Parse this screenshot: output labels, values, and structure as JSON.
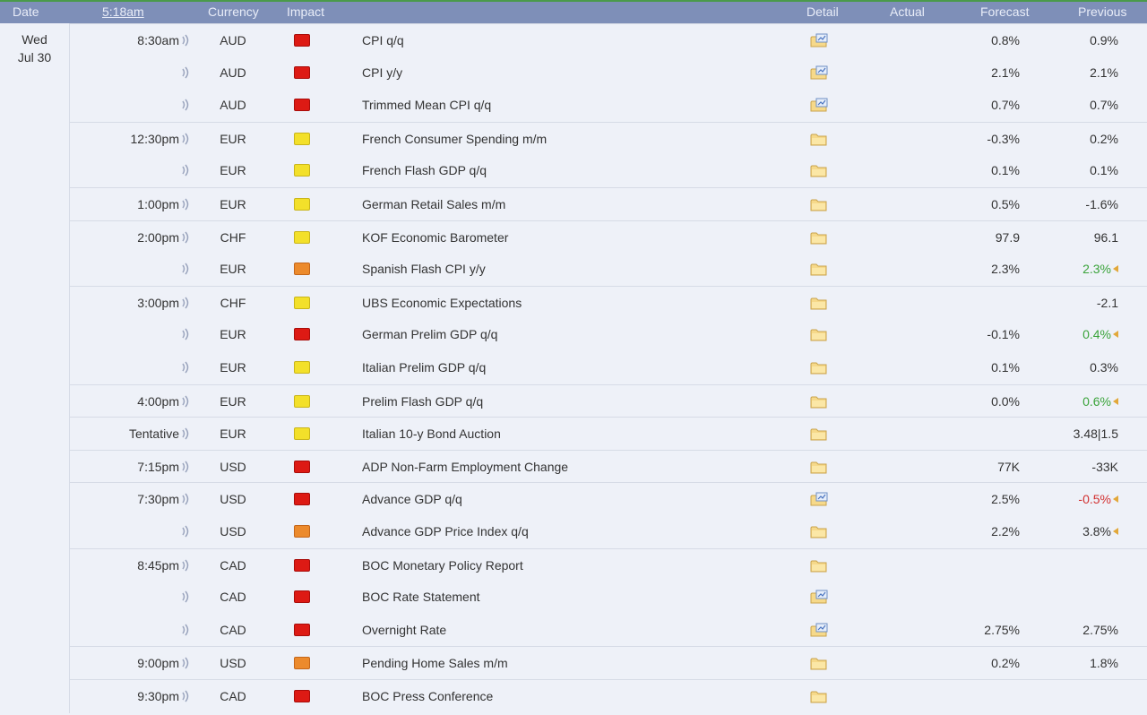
{
  "header": {
    "date": "Date",
    "time": "5:18am",
    "currency": "Currency",
    "impact": "Impact",
    "detail": "Detail",
    "actual": "Actual",
    "forecast": "Forecast",
    "previous": "Previous"
  },
  "date": {
    "day": "Wed",
    "date": "Jul 30"
  },
  "colors": {
    "red": "#dd1a14",
    "yellow": "#f3e02a",
    "orange": "#ec8a2c",
    "better": "#3aa33a",
    "worse": "#d23030",
    "header": "#7e8fb8"
  },
  "events": [
    {
      "time": "8:30am",
      "currency": "AUD",
      "impact": "red",
      "event": "CPI q/q",
      "detail_icon": "folder-chart-icon",
      "forecast": "0.8%",
      "previous": "0.9%",
      "previous_status": "",
      "revised": false
    },
    {
      "time": "",
      "currency": "AUD",
      "impact": "red",
      "event": "CPI y/y",
      "detail_icon": "folder-chart-icon",
      "forecast": "2.1%",
      "previous": "2.1%",
      "previous_status": "",
      "revised": false
    },
    {
      "time": "",
      "currency": "AUD",
      "impact": "red",
      "event": "Trimmed Mean CPI q/q",
      "detail_icon": "folder-chart-icon",
      "forecast": "0.7%",
      "previous": "0.7%",
      "previous_status": "",
      "revised": false
    },
    {
      "time": "12:30pm",
      "currency": "EUR",
      "impact": "yellow",
      "event": "French Consumer Spending m/m",
      "detail_icon": "folder-icon",
      "forecast": "-0.3%",
      "previous": "0.2%",
      "previous_status": "",
      "revised": false
    },
    {
      "time": "",
      "currency": "EUR",
      "impact": "yellow",
      "event": "French Flash GDP q/q",
      "detail_icon": "folder-icon",
      "forecast": "0.1%",
      "previous": "0.1%",
      "previous_status": "",
      "revised": false
    },
    {
      "time": "1:00pm",
      "currency": "EUR",
      "impact": "yellow",
      "event": "German Retail Sales m/m",
      "detail_icon": "folder-icon",
      "forecast": "0.5%",
      "previous": "-1.6%",
      "previous_status": "",
      "revised": false
    },
    {
      "time": "2:00pm",
      "currency": "CHF",
      "impact": "yellow",
      "event": "KOF Economic Barometer",
      "detail_icon": "folder-icon",
      "forecast": "97.9",
      "previous": "96.1",
      "previous_status": "",
      "revised": false
    },
    {
      "time": "",
      "currency": "EUR",
      "impact": "orange",
      "event": "Spanish Flash CPI y/y",
      "detail_icon": "folder-icon",
      "forecast": "2.3%",
      "previous": "2.3%",
      "previous_status": "better",
      "revised": true
    },
    {
      "time": "3:00pm",
      "currency": "CHF",
      "impact": "yellow",
      "event": "UBS Economic Expectations",
      "detail_icon": "folder-icon",
      "forecast": "",
      "previous": "-2.1",
      "previous_status": "",
      "revised": false
    },
    {
      "time": "",
      "currency": "EUR",
      "impact": "red",
      "event": "German Prelim GDP q/q",
      "detail_icon": "folder-icon",
      "forecast": "-0.1%",
      "previous": "0.4%",
      "previous_status": "better",
      "revised": true
    },
    {
      "time": "",
      "currency": "EUR",
      "impact": "yellow",
      "event": "Italian Prelim GDP q/q",
      "detail_icon": "folder-icon",
      "forecast": "0.1%",
      "previous": "0.3%",
      "previous_status": "",
      "revised": false
    },
    {
      "time": "4:00pm",
      "currency": "EUR",
      "impact": "yellow",
      "event": "Prelim Flash GDP q/q",
      "detail_icon": "folder-icon",
      "forecast": "0.0%",
      "previous": "0.6%",
      "previous_status": "better",
      "revised": true
    },
    {
      "time": "Tentative",
      "currency": "EUR",
      "impact": "yellow",
      "event": "Italian 10-y Bond Auction",
      "detail_icon": "folder-icon",
      "forecast": "",
      "previous": "3.48|1.5",
      "previous_status": "",
      "revised": false
    },
    {
      "time": "7:15pm",
      "currency": "USD",
      "impact": "red",
      "event": "ADP Non-Farm Employment Change",
      "detail_icon": "folder-icon",
      "forecast": "77K",
      "previous": "-33K",
      "previous_status": "",
      "revised": false
    },
    {
      "time": "7:30pm",
      "currency": "USD",
      "impact": "red",
      "event": "Advance GDP q/q",
      "detail_icon": "folder-chart-icon",
      "forecast": "2.5%",
      "previous": "-0.5%",
      "previous_status": "worse",
      "revised": true
    },
    {
      "time": "",
      "currency": "USD",
      "impact": "orange",
      "event": "Advance GDP Price Index q/q",
      "detail_icon": "folder-icon",
      "forecast": "2.2%",
      "previous": "3.8%",
      "previous_status": "",
      "revised": true
    },
    {
      "time": "8:45pm",
      "currency": "CAD",
      "impact": "red",
      "event": "BOC Monetary Policy Report",
      "detail_icon": "folder-icon",
      "forecast": "",
      "previous": "",
      "previous_status": "",
      "revised": false
    },
    {
      "time": "",
      "currency": "CAD",
      "impact": "red",
      "event": "BOC Rate Statement",
      "detail_icon": "folder-chart-icon",
      "forecast": "",
      "previous": "",
      "previous_status": "",
      "revised": false
    },
    {
      "time": "",
      "currency": "CAD",
      "impact": "red",
      "event": "Overnight Rate",
      "detail_icon": "folder-chart-icon",
      "forecast": "2.75%",
      "previous": "2.75%",
      "previous_status": "",
      "revised": false
    },
    {
      "time": "9:00pm",
      "currency": "USD",
      "impact": "orange",
      "event": "Pending Home Sales m/m",
      "detail_icon": "folder-icon",
      "forecast": "0.2%",
      "previous": "1.8%",
      "previous_status": "",
      "revised": false
    },
    {
      "time": "9:30pm",
      "currency": "CAD",
      "impact": "red",
      "event": "BOC Press Conference",
      "detail_icon": "folder-icon",
      "forecast": "",
      "previous": "",
      "previous_status": "",
      "revised": false
    }
  ]
}
